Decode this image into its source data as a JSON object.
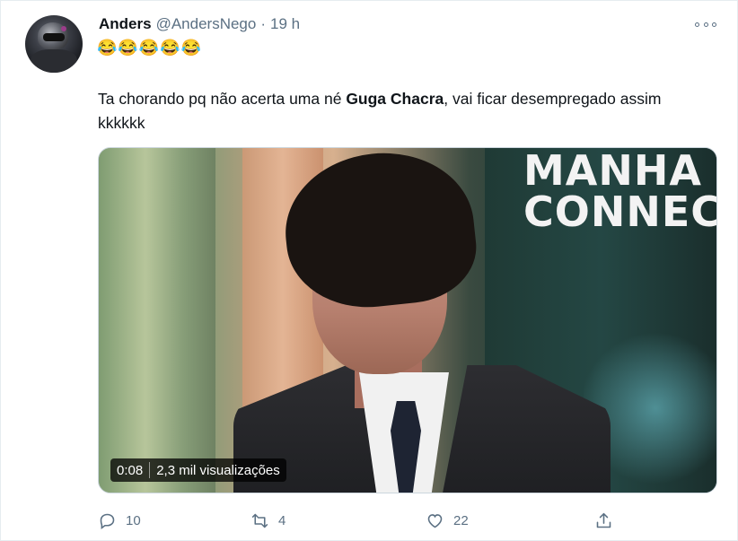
{
  "tweet": {
    "author_name": "Anders",
    "author_handle": "@AndersNego",
    "separator": "·",
    "time": "19 h",
    "emojis": "😂😂😂😂😂",
    "text_before": "Ta chorando pq não acerta uma né ",
    "text_bold": "Guga Chacra",
    "text_after": ", vai ficar desempregado assim kkkkkk"
  },
  "media": {
    "overlay_line1": "MANHA",
    "overlay_line2": "CONNEC",
    "duration": "0:08",
    "views": "2,3 mil visualizações"
  },
  "actions": {
    "reply_count": "10",
    "retweet_count": "4",
    "like_count": "22"
  },
  "icons": {
    "reply": "reply-icon",
    "retweet": "retweet-icon",
    "like": "heart-icon",
    "share": "share-icon",
    "more": "more-icon"
  },
  "colors": {
    "secondary_text": "#5b7083",
    "primary_text": "#0f1419"
  }
}
